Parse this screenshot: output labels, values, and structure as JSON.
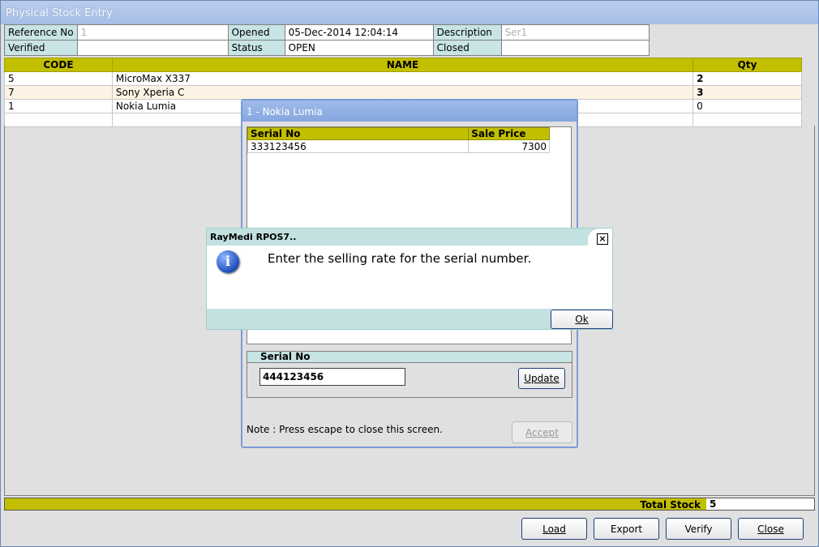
{
  "window": {
    "title": "Physical Stock Entry"
  },
  "info": {
    "reference_label": "Reference No",
    "reference_value": "1",
    "opened_label": "Opened",
    "opened_value": "05-Dec-2014 12:04:14",
    "description_label": "Description",
    "description_value": "Ser1",
    "verified_label": "Verified",
    "verified_value": "",
    "status_label": "Status",
    "status_value": "OPEN",
    "closed_label": "Closed",
    "closed_value": ""
  },
  "grid": {
    "headers": {
      "code": "CODE",
      "name": "NAME",
      "qty": "Qty"
    },
    "rows": [
      {
        "code": "5",
        "name": "MicroMax X337",
        "qty": "2"
      },
      {
        "code": "7",
        "name": "Sony Xperia C",
        "qty": "3"
      },
      {
        "code": "1",
        "name": "Nokia Lumia",
        "qty": "0"
      },
      {
        "code": "",
        "name": "",
        "qty": ""
      }
    ]
  },
  "totals": {
    "label": "Total Stock",
    "value": "5"
  },
  "buttons": {
    "load": "Load",
    "export": "Export",
    "verify": "Verify",
    "close": "Close"
  },
  "child_dialog": {
    "title": "1 - Nokia Lumia",
    "headers": {
      "serial": "Serial No",
      "price": "Sale Price"
    },
    "rows": [
      {
        "serial": "333123456",
        "price": "7300"
      }
    ],
    "serial_panel_label": "Serial No",
    "serial_input_value": "444123456",
    "update_label": "Update",
    "note": "Note : Press escape to close this screen.",
    "accept_label": "Accept"
  },
  "message_box": {
    "title": "RayMedi RPOS7..",
    "text": "Enter the selling rate for the serial number.",
    "ok_label": "Ok",
    "icon": "info-icon"
  }
}
